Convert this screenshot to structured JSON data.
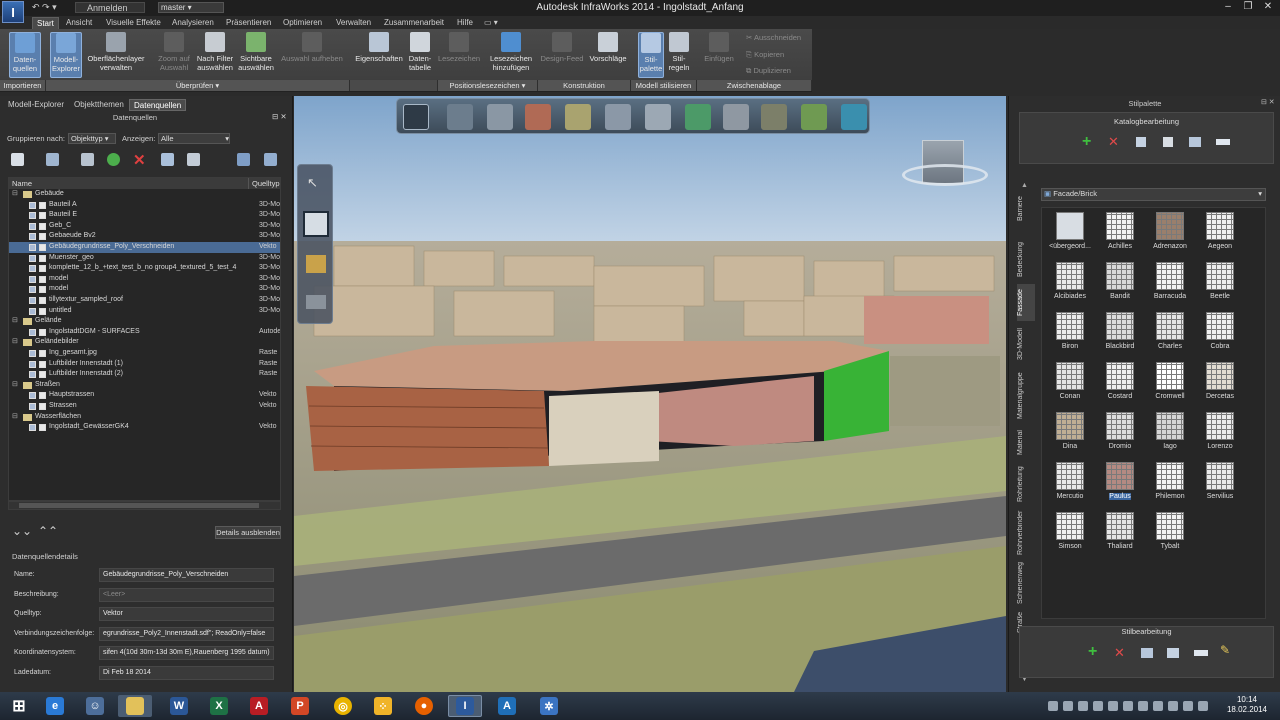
{
  "window": {
    "title": "Autodesk InfraWorks 2014 - Ingolstadt_Anfang",
    "logo": "I",
    "signin": "Anmelden",
    "dataset": "master",
    "quick_access": "↶ ↷ ▾",
    "controls": [
      "‒",
      "❐",
      "✕"
    ]
  },
  "ribbon_tabs": [
    "Start",
    "Ansicht",
    "Visuelle Effekte",
    "Analysieren",
    "Präsentieren",
    "Optimieren",
    "Verwalten",
    "Zusammenarbeit",
    "Hilfe"
  ],
  "ribbon": {
    "buttons": {
      "datenquellen": "Daten-\nquellen",
      "modell_explorer": "Modell-\nExplorer",
      "oberflaechen": "Oberflächenlayer\nverwalten",
      "zoom": "Zoom auf\nAuswahl",
      "filter": "Nach Filter\nauswählen",
      "sichtbare": "Sichtbare\nauswählen",
      "auswahl_aufheben": "Auswahl aufheben",
      "eigenschaften": "Eigenschaften",
      "datentabelle": "Daten-\ntabelle",
      "lesezeichen": "Lesezeichen",
      "lesezeichen_hinzu": "Lesezeichen\nhinzufügen",
      "design_feed": "Design-Feed",
      "vorschlaege": "Vorschläge",
      "stilpalette": "Stil-\npalette",
      "stilregeln": "Stil-\nregeln",
      "einfuegen": "Einfügen",
      "ausschneiden": "Ausschneiden",
      "kopieren": "Kopieren",
      "duplizieren": "Duplizieren"
    },
    "groups": {
      "importieren": "Importieren",
      "ueberpruefen": "Überprüfen ▾",
      "positionslesezeichen": "Positionslesezeichen ▾",
      "konstruktion": "Konstruktion",
      "modell_stilisieren": "Modell stilisieren",
      "zwischenablage": "Zwischenablage"
    }
  },
  "left_panel": {
    "tabs": [
      "Modell-Explorer",
      "Objektthemen",
      "Datenquellen"
    ],
    "section_title": "Datenquellen",
    "group_by_label": "Gruppieren nach:",
    "group_by_value": "Objekttyp",
    "show_label": "Anzeigen:",
    "show_value": "Alle",
    "columns": [
      "Name",
      "Quelltyp"
    ],
    "tree": [
      {
        "level": 0,
        "name": "Gebäude",
        "type": "",
        "folder": true
      },
      {
        "level": 1,
        "name": "Bauteil A",
        "type": "3D-Mo"
      },
      {
        "level": 1,
        "name": "Bauteil E",
        "type": "3D-Mo"
      },
      {
        "level": 1,
        "name": "Geb_C",
        "type": "3D-Mo"
      },
      {
        "level": 1,
        "name": "Gebaeude Bv2",
        "type": "3D-Mo"
      },
      {
        "level": 1,
        "name": "Gebäudegrundrisse_Poly_Verschneiden",
        "type": "Vekto",
        "selected": true
      },
      {
        "level": 1,
        "name": "Muenster_geo",
        "type": "3D-Mo"
      },
      {
        "level": 1,
        "name": "komplette_12_b_+text_test_b_no group4_textured_5_test_4",
        "type": "3D-Mo"
      },
      {
        "level": 1,
        "name": "model",
        "type": "3D-Mo"
      },
      {
        "level": 1,
        "name": "model",
        "type": "3D-Mo"
      },
      {
        "level": 1,
        "name": "tillytextur_sampled_roof",
        "type": "3D-Mo"
      },
      {
        "level": 1,
        "name": "untitled",
        "type": "3D-Mo"
      },
      {
        "level": 0,
        "name": "Gelände",
        "type": "",
        "folder": true
      },
      {
        "level": 1,
        "name": "IngolstadtDGM - SURFACES",
        "type": "Autodesk"
      },
      {
        "level": 0,
        "name": "Geländebilder",
        "type": "",
        "folder": true
      },
      {
        "level": 1,
        "name": "Ing_gesamt.jpg",
        "type": "Raste"
      },
      {
        "level": 1,
        "name": "Luftbilder Innenstadt (1)",
        "type": "Raste"
      },
      {
        "level": 1,
        "name": "Luftbilder Innenstadt (2)",
        "type": "Raste"
      },
      {
        "level": 0,
        "name": "Straßen",
        "type": "",
        "folder": true
      },
      {
        "level": 1,
        "name": "Hauptstrassen",
        "type": "Vekto"
      },
      {
        "level": 1,
        "name": "Strassen",
        "type": "Vekto"
      },
      {
        "level": 0,
        "name": "Wasserflächen",
        "type": "",
        "folder": true
      },
      {
        "level": 1,
        "name": "Ingolstadt_GewässerGK4",
        "type": "Vekto"
      }
    ],
    "details_button": "Details ausblenden",
    "details_title": "Datenquellendetails",
    "details": [
      {
        "label": "Name:",
        "value": "Gebäudegrundrisse_Poly_Verschneiden"
      },
      {
        "label": "Beschreibung:",
        "value": "<Leer>"
      },
      {
        "label": "Quelltyp:",
        "value": "Vektor"
      },
      {
        "label": "Verbindungszeichenfolge:",
        "value": "egrundrisse_Poly2_Innenstadt.sdf\"; ReadOnly=false"
      },
      {
        "label": "Koordinatensystem:",
        "value": "sifen 4(10d 30m-13d 30m E),Rauenberg 1995 datum)"
      },
      {
        "label": "Ladedatum:",
        "value": "Di Feb 18 2014"
      }
    ]
  },
  "right_panel": {
    "title": "Stilpalette",
    "catalog_edit": "Katalogbearbeitung",
    "style_edit": "Stilbearbeitung",
    "category_dropdown": "Facade/Brick",
    "side_tabs": [
      "Barriere",
      "Bedeckung",
      "Fassade",
      "3D-Modell",
      "Materialgruppe",
      "Material",
      "Rohrleitung",
      "Rohrverbinder",
      "Schienenweg",
      "Straße"
    ],
    "active_tab": "Fassade",
    "styles": [
      "<übergeord...",
      "Achilles",
      "Adrenazon",
      "Aegeon",
      "Alcibiades",
      "Bandit",
      "Barracuda",
      "Beetle",
      "Biron",
      "Blackbird",
      "Charles",
      "Cobra",
      "Conan",
      "Costard",
      "Cromwell",
      "Dercetas",
      "Dina",
      "Dromio",
      "Iago",
      "Lorenzo",
      "Mercutio",
      "Paulus",
      "Philemon",
      "Servilius",
      "Simson",
      "Thaliard",
      "Tybalt"
    ],
    "selected_style": "Paulus"
  },
  "taskbar": {
    "time": "10:14",
    "date": "18.02.2014"
  },
  "colors": {
    "accent": "#3a66a0",
    "selection": "#4a6b95",
    "ribbon": "#444444",
    "panel": "#2d2d2d"
  }
}
